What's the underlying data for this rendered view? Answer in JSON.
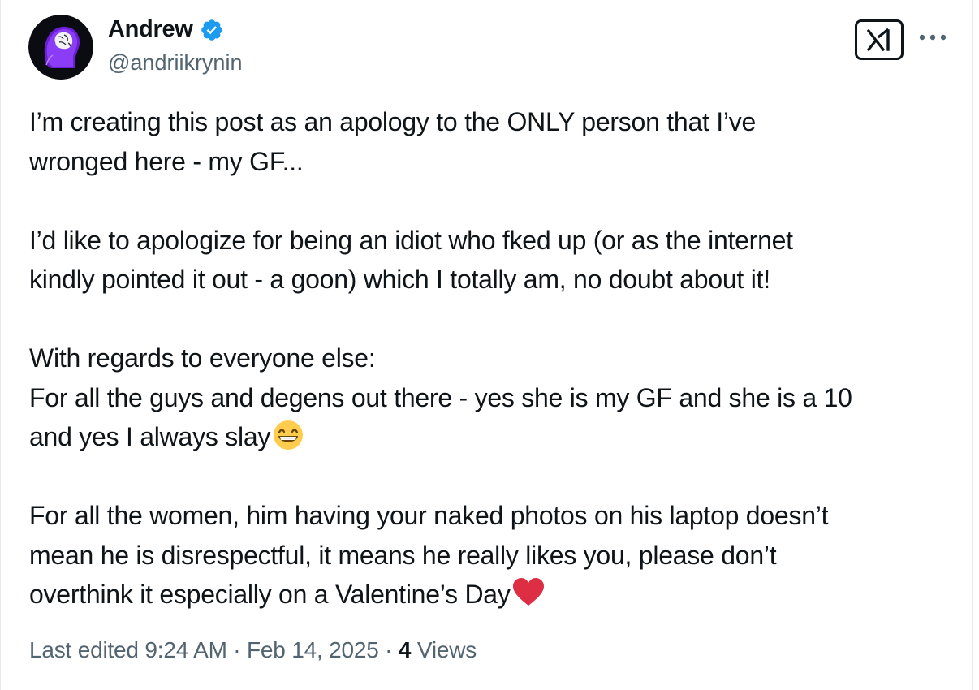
{
  "author": {
    "display_name": "Andrew",
    "handle": "@andriikrynin",
    "verified": true,
    "avatar_icon": "brain-head-avatar-icon",
    "verified_icon": "verified-badge-icon",
    "accent_color": "#1d9bf0"
  },
  "actions": {
    "grok_icon": "grok-logo-icon",
    "more_icon": "more-dots-icon"
  },
  "post": {
    "line_1": "I’m creating this post as an apology to the ONLY person that I’ve",
    "line_2": "wronged here - my GF...",
    "line_3": "I’d like to apologize for being an idiot who fked up (or as the internet",
    "line_4": "kindly pointed it out - a goon) which I totally am, no doubt about it!",
    "line_5": "With regards to everyone else:",
    "line_6": "For all the guys and degens out there - yes she is my GF and she is a 10",
    "line_7": "and yes I always slay",
    "line_7_emoji": "grinning-face-emoji",
    "line_8": "For all the women, him having your naked photos on his laptop doesn’t",
    "line_9": "mean he is disrespectful, it means he really likes you, please don’t",
    "line_10": "overthink it especially on a Valentine’s Day",
    "line_10_emoji": "red-heart-emoji"
  },
  "meta": {
    "edited_label": "Last edited 9:24 AM · Feb 14, 2025 · ",
    "views_count": "4",
    "views_label": " Views"
  },
  "colors": {
    "text_primary": "#0f1419",
    "text_secondary": "#536471",
    "heart": "#e0245e",
    "avatar_glow": "#7b2cf5"
  }
}
